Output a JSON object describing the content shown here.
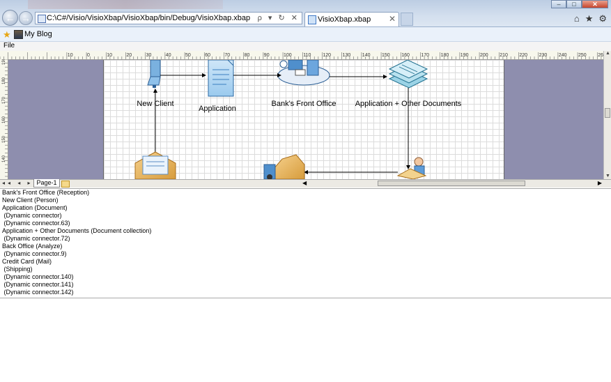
{
  "browser": {
    "address_url": "C:\\C#/Visio/VisioXbap/VisioXbap/bin/Debug/VisioXbap.xbap",
    "address_controls": "ρ ▾ ↻ ✕",
    "tab_title": "VisioXbap.xbap",
    "tab_close": "✕",
    "window_minimize": "–",
    "window_maximize": "□",
    "window_close": "✕",
    "home_icon": "⌂",
    "favorites_icon": "★",
    "tools_icon": "⚙",
    "back_icon": "←",
    "forward_icon": "→"
  },
  "favorites": {
    "star_icon": "★",
    "blog_label": "My Blog"
  },
  "menu": {
    "file": "File"
  },
  "rulers": {
    "top": [
      "10",
      "0",
      "10",
      "20",
      "30",
      "40",
      "50",
      "60",
      "70",
      "80",
      "90",
      "100",
      "110",
      "120",
      "130",
      "140",
      "150",
      "160",
      "170",
      "180",
      "190",
      "200",
      "210",
      "220",
      "230",
      "240",
      "250",
      "260"
    ],
    "left": [
      "190",
      "180",
      "170",
      "160",
      "150",
      "140"
    ]
  },
  "diagram": {
    "shapes": {
      "new_client": "New Client",
      "application": "Application",
      "front_office": "Bank's Front Office",
      "other_documents": "Application + Other Documents"
    }
  },
  "page_nav": {
    "arrows": "◂◂ ◂ ▸ ▸▸",
    "page_tab": "Page-1"
  },
  "shape_list": [
    "Bank's Front Office (Reception)",
    "New Client (Person)",
    "Application (Document)",
    " (Dynamic connector)",
    " (Dynamic connector.63)",
    "Application + Other Documents (Document collection)",
    " (Dynamic connector.72)",
    "Back Office (Analyze)",
    " (Dynamic connector.9)",
    "Credit Card (Mail)",
    " (Shipping)",
    " (Dynamic connector.140)",
    " (Dynamic connector.141)",
    " (Dynamic connector.142)"
  ]
}
